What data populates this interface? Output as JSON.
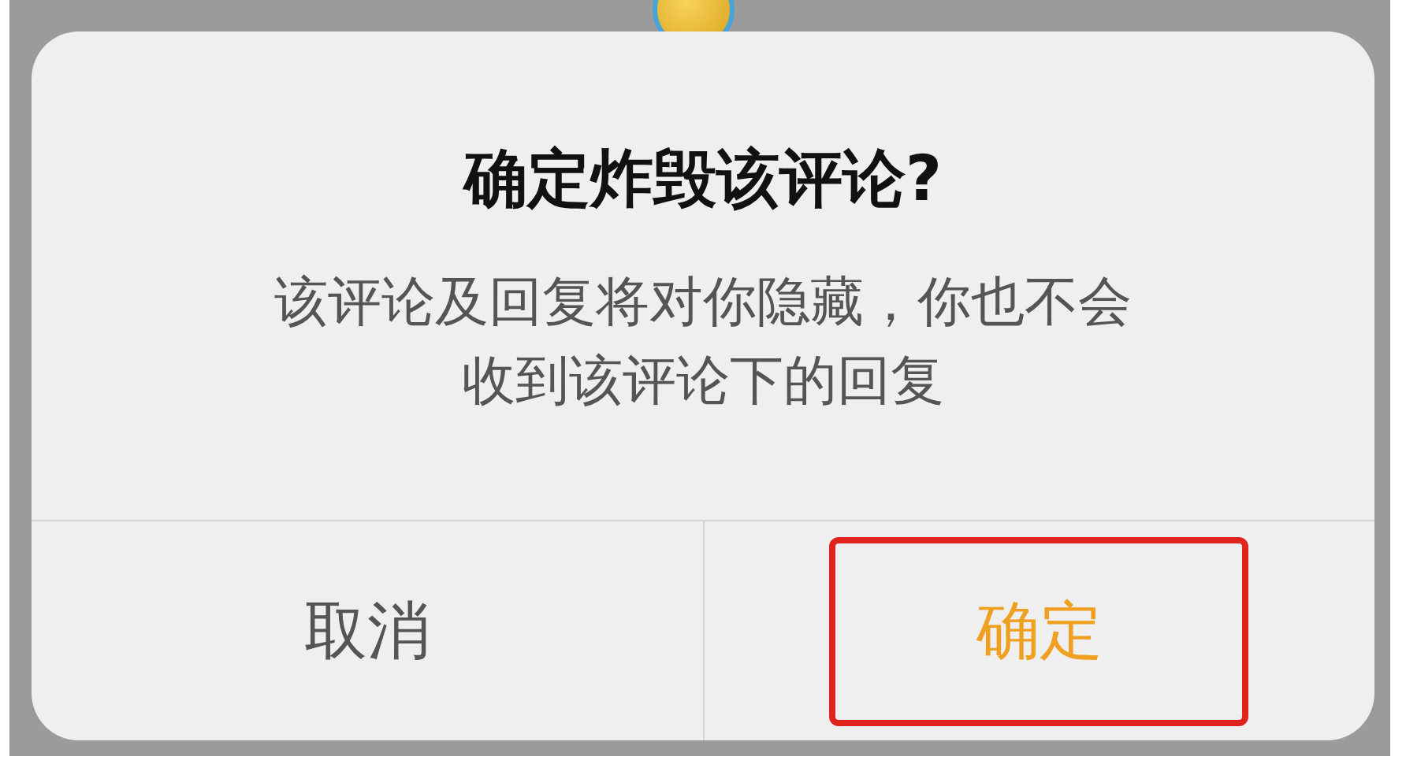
{
  "dialog": {
    "title": "确定炸毁该评论?",
    "message": "该评论及回复将对你隐藏，你也不会收到该评论下的回复",
    "buttons": [
      {
        "label": "取消",
        "kind": "cancel",
        "highlighted": false
      },
      {
        "label": "确定",
        "kind": "confirm",
        "highlighted": true
      }
    ]
  }
}
